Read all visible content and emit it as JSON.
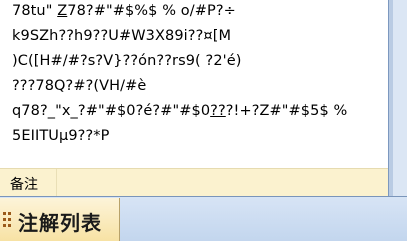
{
  "content": {
    "lines": [
      {
        "segments": [
          {
            "text": "78tu\" "
          },
          {
            "text": "Z",
            "underline": true
          },
          {
            "text": "78?#\"#$%$ % o/#P?÷"
          }
        ]
      },
      {
        "segments": [
          {
            "text": "k9SZh??h9??U#W3X89i??¤[M"
          }
        ]
      },
      {
        "segments": [
          {
            "text": ")C([H#/#?s?V}??ón??rs9( ?2'é)"
          }
        ]
      },
      {
        "segments": [
          {
            "text": "???78Q?#?(VH/#è"
          }
        ]
      },
      {
        "segments": [
          {
            "text": "q78?_\"x_?#\"#$0?é?#\"#$0"
          },
          {
            "text": "??",
            "underline": true
          },
          {
            "text": "?!+?Z#\"#$5$ %"
          }
        ]
      },
      {
        "segments": [
          {
            "text": "5EIITUµ9??*P"
          }
        ]
      }
    ]
  },
  "remark": {
    "label": "备注"
  },
  "panel_tab": {
    "label": "注解列表"
  },
  "colors": {
    "remark_bg": "#fbf2cf",
    "tab_bg": "#f7e2a4",
    "bar_bg": "#c3d6ee"
  }
}
